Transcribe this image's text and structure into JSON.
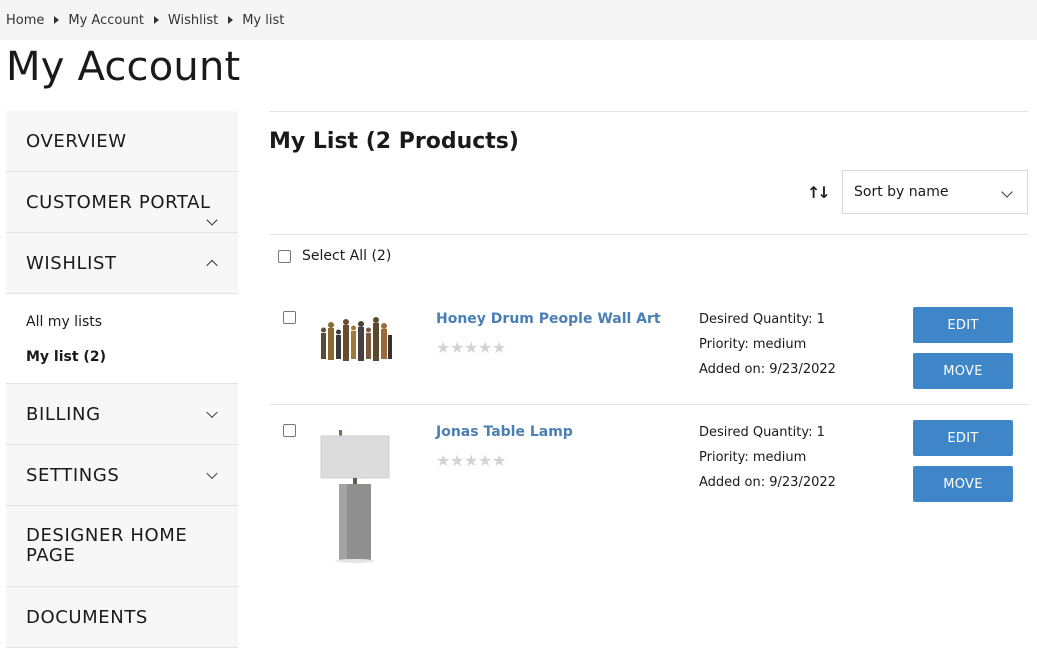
{
  "breadcrumb": {
    "items": [
      "Home",
      "My Account",
      "Wishlist",
      "My list"
    ]
  },
  "page_title": "My Account",
  "sidebar": {
    "items": [
      {
        "label": "OVERVIEW"
      },
      {
        "label": "CUSTOMER PORTAL"
      },
      {
        "label": "WISHLIST"
      },
      {
        "label": "BILLING"
      },
      {
        "label": "SETTINGS"
      },
      {
        "label": "DESIGNER HOME PAGE"
      },
      {
        "label": "DOCUMENTS"
      }
    ],
    "wishlist_sub": [
      {
        "label": "All my lists"
      },
      {
        "label": "My list (2)"
      }
    ]
  },
  "main": {
    "list_title": "My List (2 Products)",
    "sort": {
      "selected": "Sort by name"
    },
    "select_all_label": "Select All (2)",
    "products": [
      {
        "name": "Honey Drum People Wall Art",
        "desired_quantity": "Desired Quantity: 1",
        "priority": "Priority: medium",
        "added_on": "Added on: 9/23/2022",
        "edit_label": "EDIT",
        "move_label": "MOVE",
        "rating": 0
      },
      {
        "name": "Jonas Table Lamp",
        "desired_quantity": "Desired Quantity: 1",
        "priority": "Priority: medium",
        "added_on": "Added on: 9/23/2022",
        "edit_label": "EDIT",
        "move_label": "MOVE",
        "rating": 0
      }
    ]
  },
  "colors": {
    "accent": "#3f86c8",
    "link": "#4a7fb5",
    "sidebar_bg": "#f7f7f7",
    "breadcrumb_bg": "#f5f5f5"
  }
}
